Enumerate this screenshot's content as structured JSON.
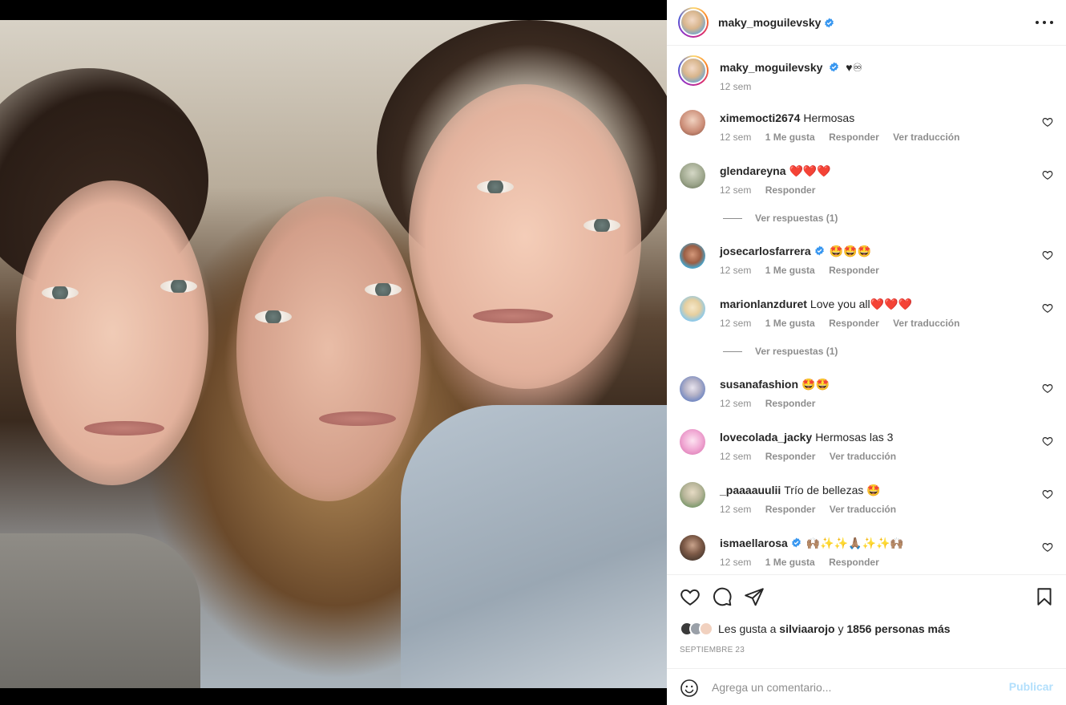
{
  "post": {
    "author": "maky_moguilevsky",
    "verified": true,
    "caption": "♥︎♾",
    "caption_time": "12 sem"
  },
  "comments": [
    {
      "user": "ximemocti2674",
      "verified": false,
      "text": "Hermosas",
      "time": "12 sem",
      "likes": "1 Me gusta",
      "reply": "Responder",
      "translate": "Ver traducción",
      "avatar_color": "#c98a74"
    },
    {
      "user": "glendareyna",
      "verified": false,
      "text": "❤️❤️❤️",
      "time": "12 sem",
      "likes": "",
      "reply": "Responder",
      "translate": "",
      "avatar_color": "#9aa389",
      "replies": "Ver respuestas (1)"
    },
    {
      "user": "josecarlosfarrera",
      "verified": true,
      "text": "🤩🤩🤩",
      "time": "12 sem",
      "likes": "1 Me gusta",
      "reply": "Responder",
      "translate": "",
      "avatar_color": "#4aa3c8"
    },
    {
      "user": "marionlanzduret",
      "verified": false,
      "text": "Love you all❤️❤️❤️",
      "time": "12 sem",
      "likes": "1 Me gusta",
      "reply": "Responder",
      "translate": "Ver traducción",
      "avatar_color": "#8ec9e8",
      "replies": "Ver respuestas (1)"
    },
    {
      "user": "susanafashion",
      "verified": false,
      "text": "🤩🤩",
      "time": "12 sem",
      "likes": "",
      "reply": "Responder",
      "translate": "",
      "avatar_color": "#6f86c2"
    },
    {
      "user": "lovecolada_jacky",
      "verified": false,
      "text": "Hermosas las 3",
      "time": "12 sem",
      "likes": "",
      "reply": "Responder",
      "translate": "Ver traducción",
      "avatar_color": "#f0a8d3"
    },
    {
      "user": "_paaaauulii",
      "verified": false,
      "text": "Trío de bellezas 🤩",
      "time": "12 sem",
      "likes": "",
      "reply": "Responder",
      "translate": "Ver traducción",
      "avatar_color": "#7f9a6e"
    },
    {
      "user": "ismaellarosa",
      "verified": true,
      "text": "🙌🏽✨✨🙏🏽✨✨🙌🏽",
      "time": "12 sem",
      "likes": "1 Me gusta",
      "reply": "Responder",
      "translate": "",
      "avatar_color": "#4a3a30"
    }
  ],
  "actions": {
    "likes_prefix": "Les gusta a",
    "likes_user": "silviaarojo",
    "likes_connector": "y",
    "likes_rest": "1856 personas más",
    "date": "SEPTIEMBRE 23"
  },
  "composer": {
    "placeholder": "Agrega un comentario...",
    "publish": "Publicar"
  },
  "colors": {
    "verified": "#3897f0",
    "muted": "#8e8e8e",
    "publish_disabled": "#b2dffc"
  },
  "icons": [
    "more-icon",
    "heart-icon",
    "comment-icon",
    "share-icon",
    "bookmark-icon",
    "emoji-icon",
    "verified-icon"
  ]
}
